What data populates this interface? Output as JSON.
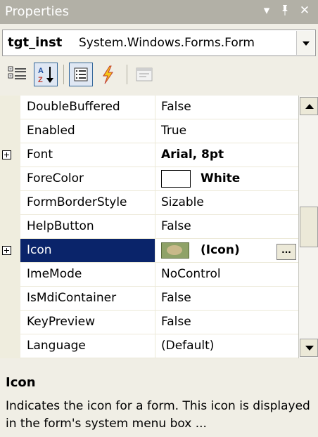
{
  "window": {
    "title": "Properties",
    "controls": {
      "pin_glyph": "▾",
      "autohide_glyph": "ᵻ",
      "close_glyph": "✕"
    }
  },
  "object_selector": {
    "name": "tgt_inst",
    "type": "System.Windows.Forms.Form"
  },
  "toolbar": {
    "buttons": [
      {
        "name": "Categorized",
        "icon": "categorized-icon",
        "pressed": false
      },
      {
        "name": "Alphabetical",
        "icon": "sort-az-icon",
        "pressed": true
      },
      {
        "name": "Properties",
        "icon": "properties-list-icon",
        "pressed": true
      },
      {
        "name": "Events",
        "icon": "lightning-icon",
        "pressed": false
      },
      {
        "name": "Property Pages",
        "icon": "property-pages-icon",
        "pressed": false
      }
    ]
  },
  "grid": {
    "rows": [
      {
        "name": "DoubleBuffered",
        "value": "False",
        "expandable": false
      },
      {
        "name": "Enabled",
        "value": "True",
        "expandable": false
      },
      {
        "name": "Font",
        "value": "Arial, 8pt",
        "expandable": true,
        "bold": true
      },
      {
        "name": "ForeColor",
        "value": "White",
        "expandable": false,
        "bold": true,
        "swatch": "#ffffff"
      },
      {
        "name": "FormBorderStyle",
        "value": "Sizable",
        "expandable": false
      },
      {
        "name": "HelpButton",
        "value": "False",
        "expandable": false
      },
      {
        "name": "Icon",
        "value": "(Icon)",
        "expandable": true,
        "bold": true,
        "selected": true,
        "ellipsis": "..."
      },
      {
        "name": "ImeMode",
        "value": "NoControl",
        "expandable": false
      },
      {
        "name": "IsMdiContainer",
        "value": "False",
        "expandable": false
      },
      {
        "name": "KeyPreview",
        "value": "False",
        "expandable": false
      },
      {
        "name": "Language",
        "value": "(Default)",
        "expandable": false
      }
    ]
  },
  "description": {
    "title": "Icon",
    "text": "Indicates the icon for a form. This icon is displayed in the form's system menu box ..."
  },
  "colors": {
    "selection": "#0a246a",
    "titlebar": "#b2b0a6",
    "panel": "#f0eee5"
  }
}
